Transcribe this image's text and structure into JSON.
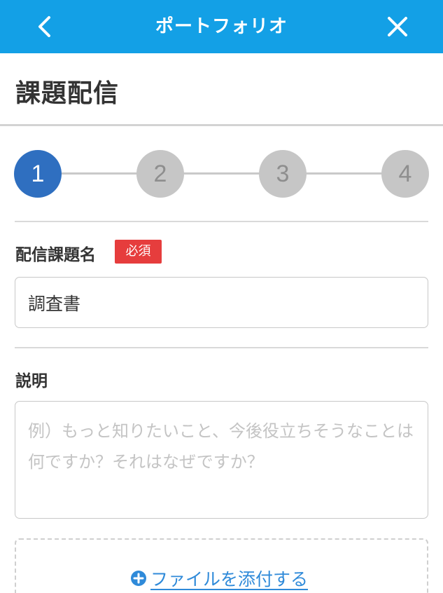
{
  "header": {
    "title": "ポートフォリオ",
    "back_icon": "chevron-left-icon",
    "close_icon": "close-icon",
    "background_color": "#13a0e6"
  },
  "page": {
    "title": "課題配信"
  },
  "stepper": {
    "steps": [
      "1",
      "2",
      "3",
      "4"
    ],
    "current_step": 1,
    "active_color": "#2f6fc0",
    "inactive_color": "#c6c6c6"
  },
  "form": {
    "task_name": {
      "label": "配信課題名",
      "required_badge": "必須",
      "value": "調査書"
    },
    "description": {
      "label": "説明",
      "placeholder": "例）もっと知りたいこと、今後役立ちそうなことは何ですか？それはなぜですか？",
      "value": ""
    },
    "attach": {
      "label": "ファイルを添付する",
      "icon": "plus-circle-icon"
    }
  },
  "colors": {
    "required": "#e63d3d",
    "link": "#2f8ad9"
  }
}
